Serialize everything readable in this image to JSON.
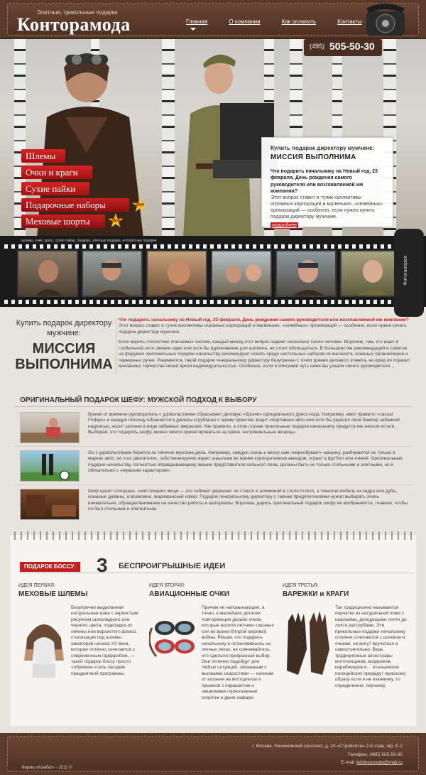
{
  "header": {
    "tagline": "Элитные, трикольные подарки",
    "logo": "Контоpамода",
    "nav": [
      "Главная",
      "О компании",
      "Как оплатить",
      "Контакты"
    ]
  },
  "hero": {
    "phone_code": "(495)",
    "phone_number": "505-50-30",
    "menu": [
      "Шлемы",
      "Очки и краги",
      "Сухие пайки",
      "Подарочные наборы",
      "Меховые шорты"
    ],
    "new_badge": "NEW",
    "promo": {
      "title": "Купить подарок директору мужчине:",
      "headline": "МИССИЯ ВЫПОЛНИМА",
      "question": "Что подарить начальнику на Новый год, 23 февраля, День рождения самого руководителя или возглавляемой им компании?",
      "answer": "Этот вопрос ставит в тупик коллективы огромных корпораций и маленьких, «семейных» организаций — особенно, если нужно купить подарок директору мужчине.",
      "more": "подробнее"
    }
  },
  "gallery": {
    "caption": "шлемы, очки, краги, сухие пайки, подарки, элитные подарки, интересные подарки",
    "label": "Фотогалерея"
  },
  "article": {
    "left_title": "Купить подарок директору мужчине:",
    "left_headline": "МИССИЯ ВЫПОЛНИМА",
    "p1_red": "Что подарить начальнику на Новый год, 23 февраля, День рождения самого руководителя или возглавляемой им компании?",
    "p1": " Этот вопрос ставит в тупик коллективы огромных корпораций и маленьких, «семейных» организаций — особенно, если нужно купить подарок директору мужчине.",
    "p2": "Если верить статистике поисковых систем, каждый месяц этот вопрос задают несколько тысяч человек. Впрочем, тем, кто ищет в глобальной сети свежие идеи или хотя бы вдохновение для шопинга, не стоит обольщаться. В большинстве рекомендаций и советов на форумах оригинальные подарки начальству рекомендуют искать среди  настольных наборов из малахита, кожаных органайзеров и паркерных ручек. Разумеется, такой подарок генеральному директору безупречен с точки зрения делового этикета, но вряд ли поразит виновника торжества своей яркой индивидуальностью. Особенно, если в описании чуть ниже вы узнали своего руководителя…"
  },
  "section": {
    "title": "ОРИГИНАЛЬНЫЙ ПОДАРОК ШЕФУ: МУЖСКОЙ ПОДХОД К ВЫБОРУ",
    "rows": [
      "Время от времени руководитель с удовольствием сбрасывает деловую «броню» официального дресс-кода. Например, ввел правило «casual Fridays» и каждую пятницу облачается в джинсы и рубашки с ярким принтом, водит спортивное авто или хотя бы украсил свой бампер забавной надписью, носит запонки в виде забавных зверюшек. Как правило, в этом случае прикольные подарки начальнику придутся как нельзя кстати. Выбирая, что подарить шефу, можно смело ориентироваться на яркие, нетривиальные вещицы.",
      "Он с удовольствием берется за типично мужские дела. Например, каждую осень и весну сам «переобувает» машину, разбирается не только в марках авто, но и их двигателях, собственноручно жарит шашлыки во время корпоративных выездов, играет в футбол или хоккей. Оригинальные подарки начальству, полностью оправдывающему звание представителя сильного пола, должны быть не только стильными и элитными, но и обязательно с «мужским характером».",
      "Шеф ценит солидные, «настоящие» вещи — его кабинет украшает не стекло и алюминий в стиле hi-tech, а тяжелая мебель из кедра или дуба, кожаные диваны, а возможно, марокканский ковер. Подарок генеральному директору с такими предпочтениями нужно выбирать очень внимательно, обращая внимание на качество работы и материалы. Впрочем, дарить оригинальный подарок шефу не возбраняется, главное, чтобы он был стильным и элегантным."
    ]
  },
  "ideas": {
    "badge": "ПОДАРОК БОССУ:",
    "number": "3",
    "title": "БЕСПРОИГРЫШНЫЕ ИДЕИ",
    "items": [
      {
        "kicker": "ИДЕЯ ПЕРВАЯ:",
        "name": "МЕХОВЫЕ ШЛЕМЫ",
        "desc": "Безупречно выделанная натуральная кожа с зернистым рисунком шоколадного или черного цвета, подкладка из овчины или ворсистого флиса, стилизация под шлемы авиаторов начала XX века, которая отлично сочетается с современным гардеробом, — такой подарок боссу просто «обречен» стать гвоздем праздничной программы."
      },
      {
        "kicker": "ИДЕЯ ВТОРАЯ:",
        "name": "АВИАЦИОННЫЕ ОЧКИ",
        "desc": "Причем не напоминающие, а точно, в малейших деталях повторяющие дизайн очков, которые носили летчики союзных сил во время Второй мировой войны. Решая, что подарить начальнику и остановившись на летных очках, не сомневайтесь, что сделали прекрасный выбор. Они отлично подойдут для любых ситуаций, связанным с высокими скоростями — начиная от катания на мотоциклах и прыжков с парашютом и заканчивая горнолыжным спортом и джип-сафари."
      },
      {
        "kicker": "ИДЕЯ ТРЕТЬЯ:",
        "name": "ВАРЕЖКИ и КРАГИ",
        "desc": "Так традиционно называются перчатки из натуральной кожи с широкими, доходящими почти до локтя раструбами. Эти прикольные подарки начальнику отлично сочетаются с шлемом и очками, но могут вручаться и самостоятельно. Ведь традиционные аксессуары мотогонщиков, всадников, карабинеров и… итальянских полицейских придадут мужскому образу если и не изюминку, то определенно, перчинку."
      }
    ]
  },
  "footer": {
    "address": "г. Москва, Нахимовский проспект, д. 24 «Стройсити» 2-й этаж, оф. Е-2",
    "phone": "Телефон: (495) 505-50-30",
    "email_label": "E-mail:",
    "email": "kdrilocamoda@mail.ru",
    "copyright": "Фирма «Комбат» - 2011 ©"
  }
}
